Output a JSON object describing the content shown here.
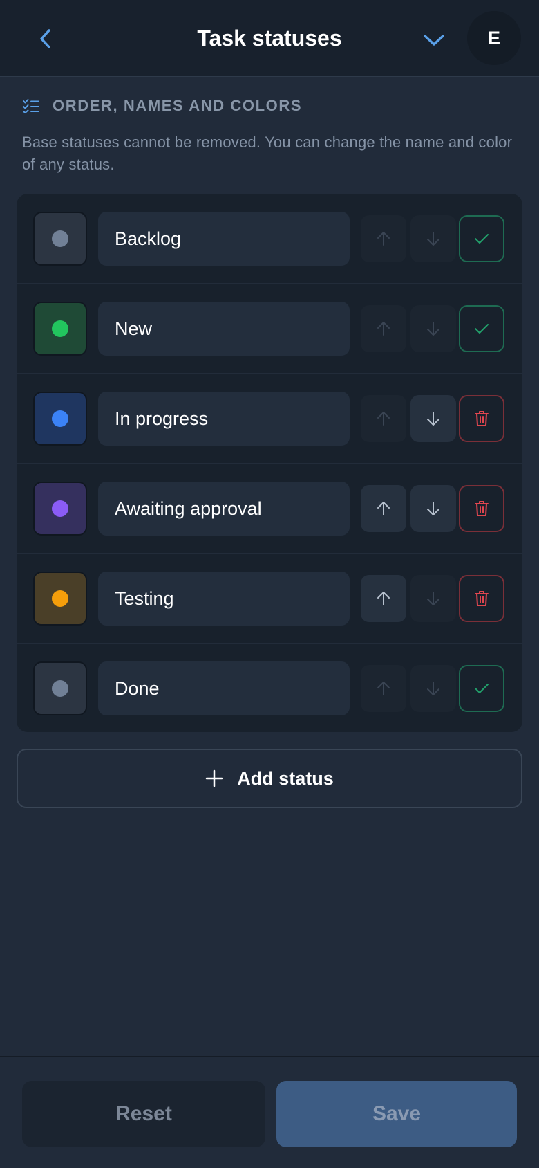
{
  "header": {
    "title": "Task statuses",
    "back_icon": "chevron-left-icon",
    "dropdown_icon": "chevron-down-icon",
    "avatar_initial": "E"
  },
  "section": {
    "icon": "checklist-icon",
    "title": "ORDER, NAMES AND COLORS",
    "description": "Base statuses cannot be removed. You can change the name and color of any status."
  },
  "statuses": [
    {
      "name": "Backlog",
      "dot_color": "#718096",
      "swatch_bg": "#2c3542",
      "up_enabled": false,
      "down_enabled": false,
      "action": "base"
    },
    {
      "name": "New",
      "dot_color": "#22c55e",
      "swatch_bg": "#1f4a36",
      "up_enabled": false,
      "down_enabled": false,
      "action": "base"
    },
    {
      "name": "In progress",
      "dot_color": "#3b82f6",
      "swatch_bg": "#1f3660",
      "up_enabled": false,
      "down_enabled": true,
      "action": "remove"
    },
    {
      "name": "Awaiting approval",
      "dot_color": "#8b5cf6",
      "swatch_bg": "#35305e",
      "up_enabled": true,
      "down_enabled": true,
      "action": "remove"
    },
    {
      "name": "Testing",
      "dot_color": "#f59e0b",
      "swatch_bg": "#4a3f28",
      "up_enabled": true,
      "down_enabled": false,
      "action": "remove"
    },
    {
      "name": "Done",
      "dot_color": "#718096",
      "swatch_bg": "#2c3542",
      "up_enabled": false,
      "down_enabled": false,
      "action": "base"
    }
  ],
  "add_button": {
    "label": "Add status",
    "icon": "plus-icon"
  },
  "footer": {
    "reset_label": "Reset",
    "save_label": "Save"
  },
  "colors": {
    "accent": "#5aa0e8",
    "base_check": "#22a06b",
    "remove_red": "#e0464f"
  }
}
